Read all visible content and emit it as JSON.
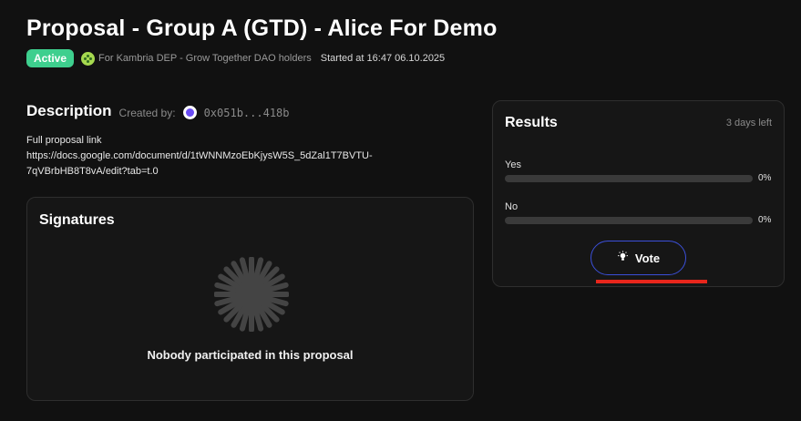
{
  "proposal": {
    "title": "Proposal - Group A (GTD) - Alice For Demo",
    "status": "Active",
    "dao_label": "For Kambria DEP - Grow Together DAO holders",
    "started": "Started at 16:47 06.10.2025"
  },
  "description": {
    "heading": "Description",
    "created_by_label": "Created by:",
    "author_address": "0x051b...418b",
    "body_line1": "Full proposal link",
    "body_line2": "https://docs.google.com/document/d/1tWNNMzoEbKjysW5S_5dZal1T7BVTU-7qVBrbHB8T8vA/edit?tab=t.0"
  },
  "signatures": {
    "heading": "Signatures",
    "empty_text": "Nobody participated in this proposal"
  },
  "results": {
    "heading": "Results",
    "time_left": "3 days left",
    "options": [
      {
        "label": "Yes",
        "percent_text": "0%",
        "percent": 0
      },
      {
        "label": "No",
        "percent_text": "0%",
        "percent": 0
      }
    ],
    "vote_label": "Vote"
  },
  "colors": {
    "active_badge": "#3ecf8e",
    "vote_border": "#3b4fd8",
    "highlight": "#e8261c"
  },
  "icons": {
    "dao": "dao-logo-icon",
    "avatar": "author-avatar-icon",
    "spinner": "loading-spinner-icon",
    "vote": "lightbulb-icon"
  }
}
